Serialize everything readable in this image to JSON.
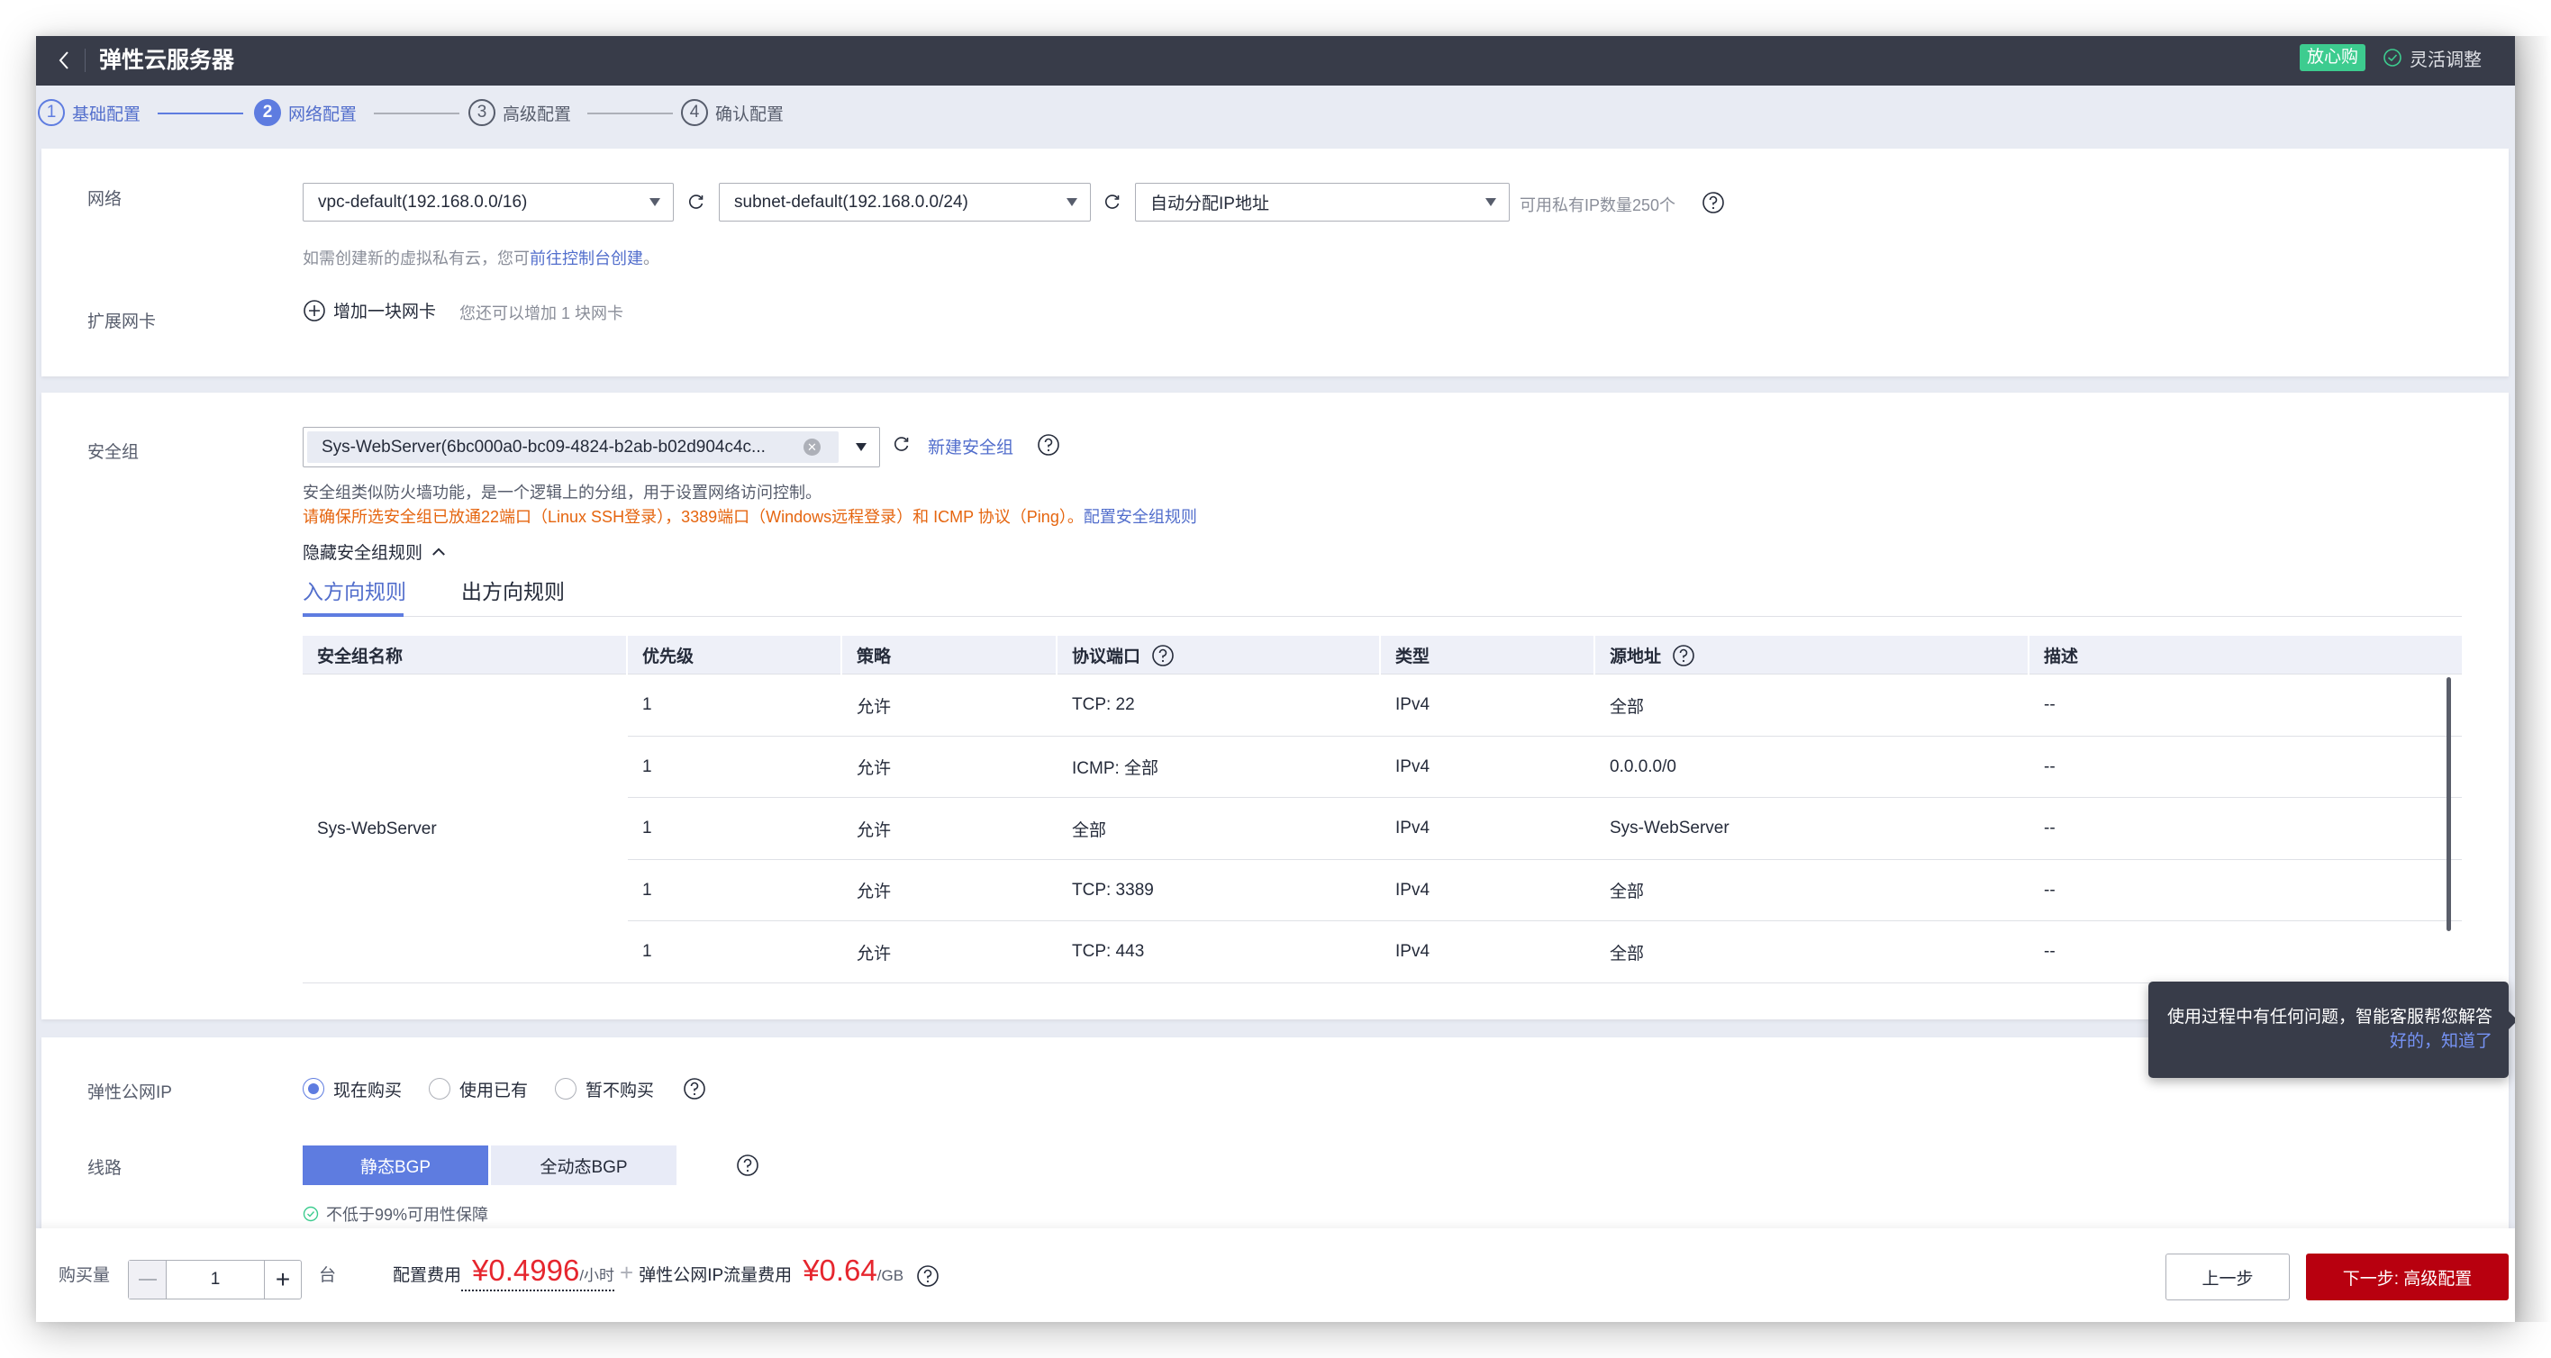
{
  "header": {
    "back_icon": "chevron-left-icon",
    "title": "弹性云服务器",
    "badge": "放心购",
    "flex_adjust": "灵活调整",
    "flex_adjust_icon": "check-circle-icon"
  },
  "steps": [
    {
      "num": "1",
      "label": "基础配置",
      "state": "done"
    },
    {
      "num": "2",
      "label": "网络配置",
      "state": "active"
    },
    {
      "num": "3",
      "label": "高级配置",
      "state": "todo"
    },
    {
      "num": "4",
      "label": "确认配置",
      "state": "todo"
    }
  ],
  "network": {
    "label": "网络",
    "vpc_value": "vpc-default(192.168.0.0/16)",
    "subnet_value": "subnet-default(192.168.0.0/24)",
    "ip_value": "自动分配IP地址",
    "available_ip": "可用私有IP数量250个",
    "create_hint_prefix": "如需创建新的虚拟私有云，您可",
    "create_hint_link": "前往控制台创建",
    "create_hint_suffix": "。",
    "ext_nic_label": "扩展网卡",
    "add_nic": "增加一块网卡",
    "add_nic_hint": "您还可以增加 1 块网卡"
  },
  "security_group": {
    "label": "安全组",
    "selected": "Sys-WebServer(6bc000a0-bc09-4824-b2ab-b02d904c4c...",
    "create_link": "新建安全组",
    "desc": "安全组类似防火墙功能，是一个逻辑上的分组，用于设置网络访问控制。",
    "warning": "请确保所选安全组已放通22端口（Linux SSH登录），3389端口（Windows远程登录）和 ICMP 协议（Ping）。",
    "config_link": "配置安全组规则",
    "toggle_rules": "隐藏安全组规则",
    "tabs": [
      {
        "label": "入方向规则",
        "active": true
      },
      {
        "label": "出方向规则",
        "active": false
      }
    ],
    "table": {
      "columns": [
        "安全组名称",
        "优先级",
        "策略",
        "协议端口",
        "类型",
        "源地址",
        "描述"
      ],
      "group_name": "Sys-WebServer",
      "rows": [
        {
          "priority": "1",
          "action": "允许",
          "port": "TCP: 22",
          "type": "IPv4",
          "source": "全部",
          "source_is_link": false,
          "desc": "--"
        },
        {
          "priority": "1",
          "action": "允许",
          "port": "ICMP: 全部",
          "type": "IPv4",
          "source": "0.0.0.0/0",
          "source_is_link": false,
          "desc": "--"
        },
        {
          "priority": "1",
          "action": "允许",
          "port": "全部",
          "type": "IPv4",
          "source": "Sys-WebServer",
          "source_is_link": true,
          "desc": "--"
        },
        {
          "priority": "1",
          "action": "允许",
          "port": "TCP: 3389",
          "type": "IPv4",
          "source": "全部",
          "source_is_link": false,
          "desc": "--"
        },
        {
          "priority": "1",
          "action": "允许",
          "port": "TCP: 443",
          "type": "IPv4",
          "source": "全部",
          "source_is_link": false,
          "desc": "--"
        }
      ]
    }
  },
  "eip": {
    "label": "弹性公网IP",
    "options": [
      {
        "label": "现在购买",
        "checked": true
      },
      {
        "label": "使用已有",
        "checked": false
      },
      {
        "label": "暂不购买",
        "checked": false
      }
    ],
    "line_label": "线路",
    "line_options": [
      {
        "label": "静态BGP",
        "active": true
      },
      {
        "label": "全动态BGP",
        "active": false
      }
    ],
    "sla": "不低于99%可用性保障"
  },
  "footer": {
    "qty_label": "购买量",
    "qty_value": "1",
    "qty_unit": "台",
    "config_fee_label": "配置费用",
    "config_fee": "¥0.4996",
    "config_fee_unit": "/小时",
    "plus": "+",
    "eip_fee_label": "弹性公网IP流量费用",
    "eip_fee": "¥0.64",
    "eip_fee_unit": "/GB",
    "prev_button": "上一步",
    "next_button": "下一步: 高级配置"
  },
  "tooltip": {
    "text": "使用过程中有任何问题，智能客服帮您解答",
    "ok": "好的，知道了"
  },
  "side_toolbar": [
    "agent-icon",
    "help-icon",
    "document-icon",
    "smile-icon"
  ],
  "colors": {
    "header_bg": "#383c49",
    "brand_blue": "#5e7ce0",
    "next_button": "#b8000f",
    "price_red": "#e6262e",
    "warning_orange": "#e5650f",
    "badge_green": "#3dcc8f"
  }
}
